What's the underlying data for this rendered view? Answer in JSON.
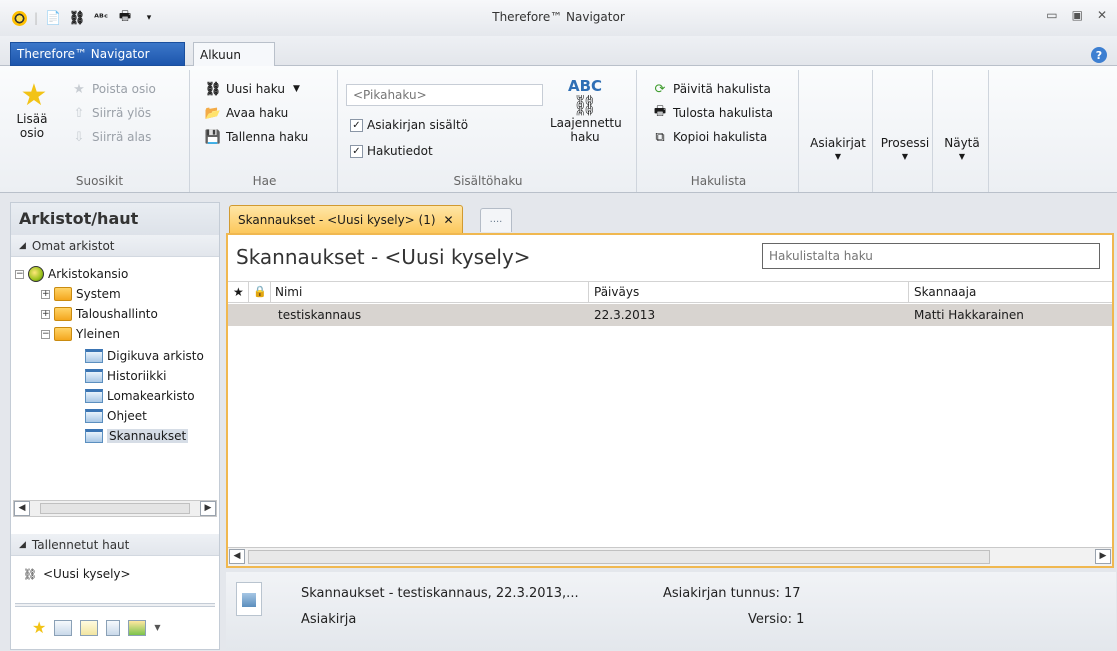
{
  "window": {
    "title": "Therefore™ Navigator",
    "controls": {
      "minimize": "▭",
      "restore": "▣",
      "close": "✕"
    }
  },
  "tabs": {
    "app_menu": "Therefore™ Navigator",
    "home": "Alkuun",
    "help": "?"
  },
  "ribbon": {
    "favorites": {
      "label": "Suosikit",
      "add": "Lisää osio",
      "remove": "Poista osio",
      "move_up": "Siirrä ylös",
      "move_down": "Siirrä alas"
    },
    "search": {
      "label": "Hae",
      "new": "Uusi haku",
      "open": "Avaa haku",
      "save": "Tallenna haku"
    },
    "content_search": {
      "label": "Sisältöhaku",
      "quick_placeholder": "<Pikahaku>",
      "doc_content": "Asiakirjan sisältö",
      "search_info": "Hakutiedot",
      "extended": "Laajennettu haku",
      "doc_content_checked": true,
      "search_info_checked": true
    },
    "hitlist": {
      "label": "Hakulista",
      "refresh": "Päivitä hakulista",
      "print": "Tulosta hakulista",
      "copy": "Kopioi hakulista"
    },
    "documents": "Asiakirjat",
    "process": "Prosessi",
    "view": "Näytä"
  },
  "left_pane": {
    "title": "Arkistot/haut",
    "my_archives": "Omat arkistot",
    "root": "Arkistokansio",
    "tree": [
      {
        "label": "System",
        "level": 1,
        "type": "folder",
        "expander": "+"
      },
      {
        "label": "Taloushallinto",
        "level": 1,
        "type": "folder",
        "expander": "+"
      },
      {
        "label": "Yleinen",
        "level": 1,
        "type": "folder",
        "expander": "−"
      },
      {
        "label": "Digikuva arkisto",
        "level": 2,
        "type": "archive"
      },
      {
        "label": "Historiikki",
        "level": 2,
        "type": "archive"
      },
      {
        "label": "Lomakearkisto",
        "level": 2,
        "type": "archive"
      },
      {
        "label": "Ohjeet",
        "level": 2,
        "type": "archive"
      },
      {
        "label": "Skannaukset",
        "level": 2,
        "type": "archive",
        "selected": true
      }
    ],
    "saved_searches": "Tallennetut haut",
    "saved_items": [
      "<Uusi kysely>"
    ]
  },
  "content": {
    "tab_label": "Skannaukset - <Uusi kysely> (1)",
    "tab_close": "✕",
    "more_tab": "....",
    "title": "Skannaukset - <Uusi kysely>",
    "hit_search_placeholder": "Hakulistalta haku",
    "columns": [
      "Nimi",
      "Päiväys",
      "Skannaaja"
    ],
    "rows": [
      {
        "name": "testiskannaus",
        "date": "22.3.2013",
        "scanner": "Matti Hakkarainen"
      }
    ]
  },
  "preview": {
    "title": "Skannaukset - testiskannaus, 22.3.2013,...",
    "type": "Asiakirja",
    "doc_id_label": "Asiakirjan tunnus: 17",
    "version_label": "Versio: 1"
  }
}
